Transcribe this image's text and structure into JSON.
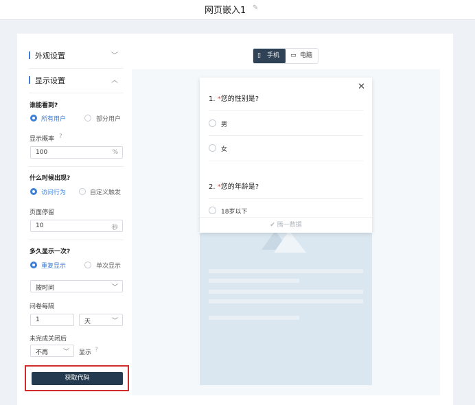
{
  "header": {
    "title": "网页嵌入1"
  },
  "sidebar": {
    "appearance_label": "外观设置",
    "display_label": "显示设置",
    "who_title": "谁能看到?",
    "who_options": [
      "所有用户",
      "部分用户"
    ],
    "prob_label": "显示概率",
    "prob_value": "100",
    "prob_unit": "%",
    "when_title": "什么时候出现?",
    "when_options": [
      "访问行为",
      "自定义触发"
    ],
    "stay_label": "页面停留",
    "stay_value": "10",
    "stay_unit": "秒",
    "freq_title": "多久显示一次?",
    "freq_options": [
      "重复显示",
      "单次显示"
    ],
    "by_select": "按时间",
    "interval_label": "问卷每隔",
    "interval_value": "1",
    "interval_unit": "天",
    "after_close_label": "未完成关闭后",
    "after_close_select": "不再",
    "after_close_suffix": "显示",
    "get_code": "获取代码"
  },
  "device": {
    "mobile": "手机",
    "desktop": "电脑",
    "selected": "手机"
  },
  "preview": {
    "q1_num": "1.",
    "q1_star": "*",
    "q1_text": "您的性别是?",
    "q1_options": [
      "男",
      "女"
    ],
    "q2_num": "2.",
    "q2_star": "*",
    "q2_text": "您的年龄是?",
    "q2_partial": "18岁以下",
    "brand": "腾一数据"
  },
  "colors": {
    "accent": "#3d7fd8",
    "button": "#243a4f",
    "highlight": "#d12a2a"
  }
}
